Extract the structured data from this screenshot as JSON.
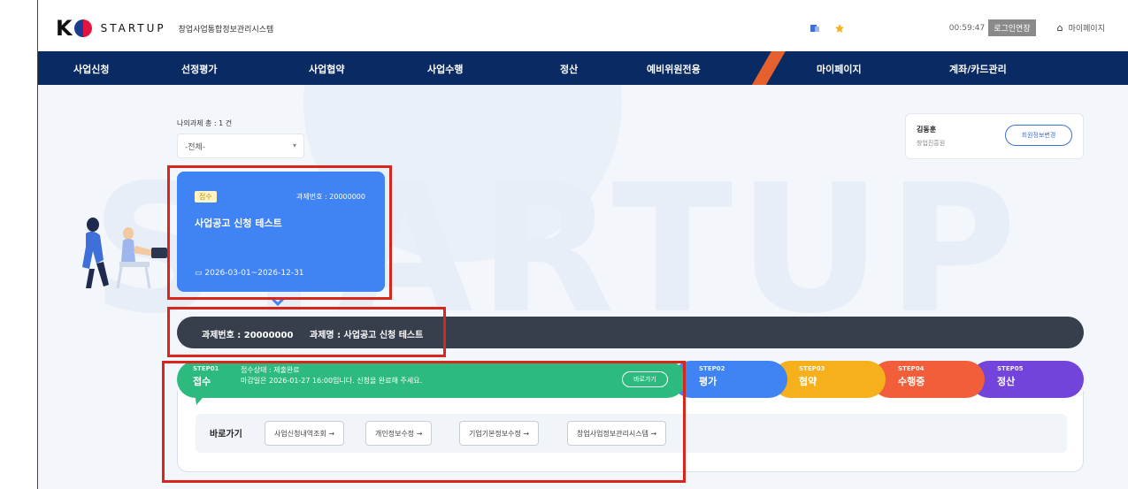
{
  "header": {
    "logo_k": "K",
    "logo_startup": "STARTUP",
    "system_name": "창업사업통합정보관리시스템",
    "timer": "00:59:47",
    "extend_login_label": "로그인연장",
    "home_label": "마이페이지"
  },
  "nav": {
    "items": [
      "사업신청",
      "선정평가",
      "사업협약",
      "사업수행",
      "정산",
      "예비위원전용",
      "마이페이지",
      "계좌/카드관리"
    ]
  },
  "filter": {
    "count_text": "나의과제 총 : 1 건",
    "select_value": "-전체-"
  },
  "user_card": {
    "name": "김동훈",
    "role": "창업진흥원",
    "info_button": "회원정보변경"
  },
  "task_card": {
    "badge": "접수",
    "task_number": "과제번호 : 20000000",
    "title": "사업공고 신청 테스트",
    "date_range": "2026-03-01~2026-12-31"
  },
  "info_bar": {
    "task_number": "과제번호 : 20000000",
    "task_name": "과제명 : 사업공고 신청 테스트"
  },
  "steps": {
    "step1": {
      "no": "STEP01",
      "name": "접수",
      "status": "접수상태 : 제출완료",
      "note": "마감일은 2026-01-27 16:00입니다. 신청을 완료해 주세요.",
      "button": "바로가기"
    },
    "step2": {
      "no": "STEP02",
      "name": "평가"
    },
    "step3": {
      "no": "STEP03",
      "name": "협약"
    },
    "step4": {
      "no": "STEP04",
      "name": "수행중"
    },
    "step5": {
      "no": "STEP05",
      "name": "정산"
    }
  },
  "quick_links": {
    "label": "바로가기",
    "buttons": [
      "사업신청내역조회 →",
      "개인정보수정 →",
      "기업기본정보수정 →",
      "창업사업정보관리시스템 →"
    ]
  },
  "background": {
    "watermark": "STARTUP"
  },
  "colors": {
    "nav": "#0a2a63",
    "task_card": "#4083f4",
    "step1": "#2cba7e",
    "step2": "#4083f4",
    "step3": "#f6b01b",
    "step4": "#f25e3a",
    "step5": "#7344dc",
    "highlight": "#d9261c"
  }
}
